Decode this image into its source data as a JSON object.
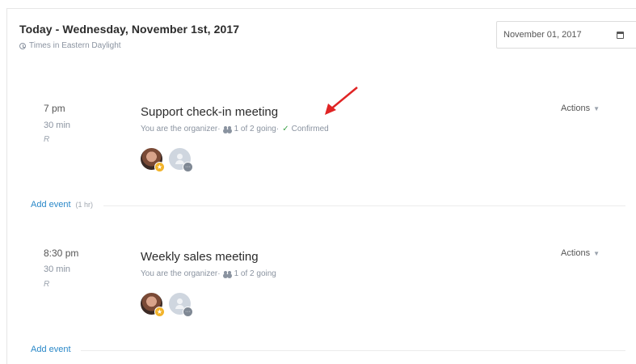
{
  "header": {
    "title": "Today - Wednesday, November 1st, 2017",
    "timezone": "Times in Eastern Daylight"
  },
  "date_picker": {
    "value": "November 01, 2017"
  },
  "events": [
    {
      "time": "7 pm",
      "duration": "30 min",
      "recurrence": "R",
      "title": "Support check-in meeting",
      "role": "You are the organizer·",
      "attendance": "1 of 2 going·",
      "status": "Confirmed",
      "actions_label": "Actions"
    },
    {
      "time": "8:30 pm",
      "duration": "30 min",
      "recurrence": "R",
      "title": "Weekly sales meeting",
      "role": "You are the organizer·",
      "attendance": "1 of 2 going",
      "status": "",
      "actions_label": "Actions"
    }
  ],
  "add_event": {
    "label": "Add event",
    "hint": "(1 hr)"
  },
  "colors": {
    "link": "#2a88c8",
    "confirmed": "#3ea24a",
    "annotation_arrow": "#e02424"
  },
  "icons": [
    "clock-icon",
    "calendar-icon",
    "people-icon",
    "check-icon",
    "chevron-down-icon",
    "star-badge-icon",
    "more-icon"
  ]
}
